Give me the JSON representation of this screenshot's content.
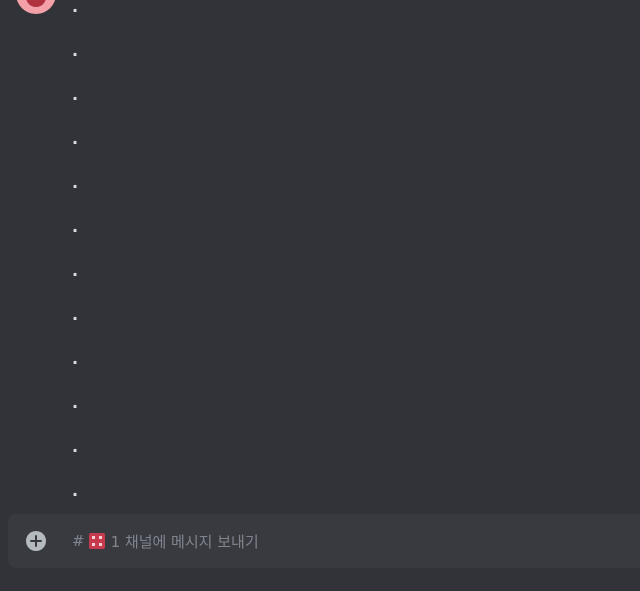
{
  "messages": {
    "lines": [
      ".",
      ".",
      ".",
      ".",
      ".",
      ".",
      ".",
      ".",
      ".",
      ".",
      ".",
      "."
    ]
  },
  "composer": {
    "hash": "#",
    "channel_name": "1 채널에 메시지 보내기",
    "icon": "plus-circle-icon",
    "channel_icon": "channel-emoji-icon"
  },
  "colors": {
    "background": "#313338",
    "composer": "#383a40",
    "placeholder": "#80848e",
    "avatar": "#f3a0a8"
  }
}
